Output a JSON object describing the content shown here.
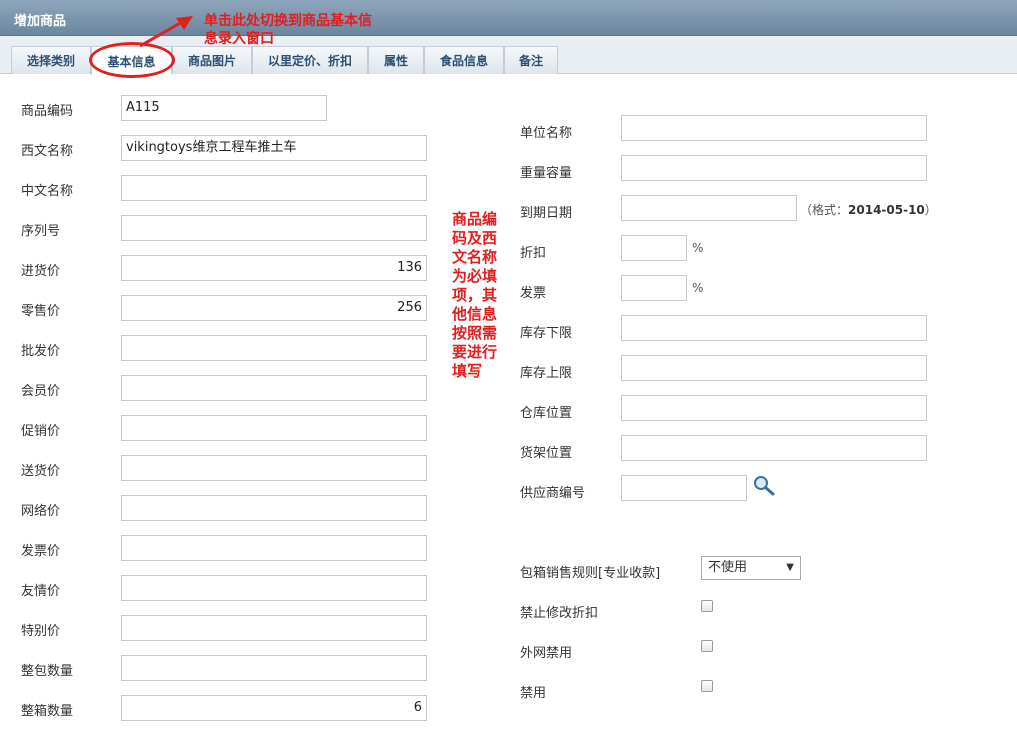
{
  "window": {
    "title": "增加商品"
  },
  "tabs": [
    {
      "label": "选择类别"
    },
    {
      "label": "基本信息"
    },
    {
      "label": "商品图片"
    },
    {
      "label": "以里定价、折扣"
    },
    {
      "label": "属性"
    },
    {
      "label": "食品信息"
    },
    {
      "label": "备注"
    }
  ],
  "annotations": {
    "top_line1": "单击此处切换到商品基本信",
    "top_line2": "息录入窗口",
    "middle": "商品编码及西文名称为必填项，其他信息按照需要进行填写"
  },
  "left_fields": [
    {
      "label": "商品编码",
      "value": "A115"
    },
    {
      "label": "西文名称",
      "value": "vikingtoys维京工程车推土车"
    },
    {
      "label": "中文名称",
      "value": ""
    },
    {
      "label": "序列号",
      "value": ""
    },
    {
      "label": "进货价",
      "value": "136"
    },
    {
      "label": "零售价",
      "value": "256"
    },
    {
      "label": "批发价",
      "value": ""
    },
    {
      "label": "会员价",
      "value": ""
    },
    {
      "label": "促销价",
      "value": ""
    },
    {
      "label": "送货价",
      "value": ""
    },
    {
      "label": "网络价",
      "value": ""
    },
    {
      "label": "发票价",
      "value": ""
    },
    {
      "label": "友情价",
      "value": ""
    },
    {
      "label": "特别价",
      "value": ""
    },
    {
      "label": "整包数量",
      "value": ""
    },
    {
      "label": "整箱数量",
      "value": "6"
    }
  ],
  "right_fields": {
    "unit_name": {
      "label": "单位名称",
      "value": ""
    },
    "weight": {
      "label": "重量容量",
      "value": ""
    },
    "expiry": {
      "label": "到期日期",
      "value": "",
      "hint_prefix": "（格式：",
      "hint_format": "2014-05-10",
      "hint_suffix": "）"
    },
    "discount": {
      "label": "折扣",
      "value": "",
      "unit": "%"
    },
    "invoice": {
      "label": "发票",
      "value": "",
      "unit": "%"
    },
    "stock_min": {
      "label": "库存下限",
      "value": ""
    },
    "stock_max": {
      "label": "库存上限",
      "value": ""
    },
    "warehouse": {
      "label": "仓库位置",
      "value": ""
    },
    "shelf": {
      "label": "货架位置",
      "value": ""
    },
    "supplier": {
      "label": "供应商编号",
      "value": ""
    },
    "box_rule": {
      "label": "包箱销售规则[专业收款]",
      "selected": "不使用"
    },
    "no_discount_edit": {
      "label": "禁止修改折扣",
      "checked": false
    },
    "no_external": {
      "label": "外网禁用",
      "checked": false
    },
    "disabled": {
      "label": "禁用",
      "checked": false
    }
  },
  "colors": {
    "annotation": "#e02020",
    "tab_text": "#2c4f73"
  }
}
